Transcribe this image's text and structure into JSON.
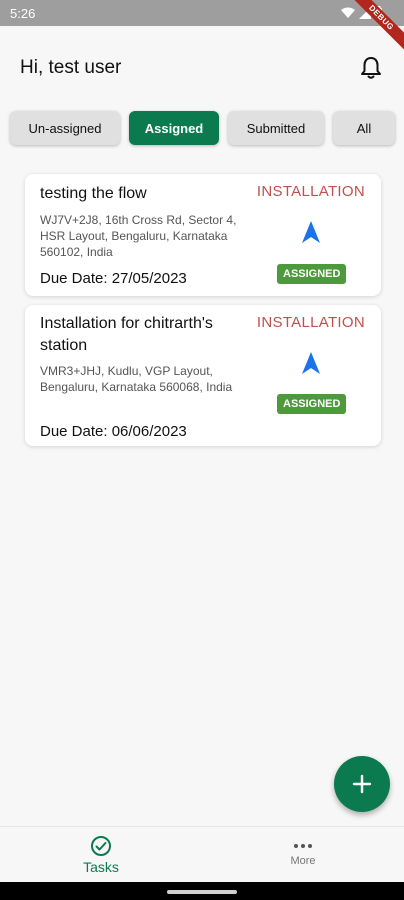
{
  "status_bar": {
    "time": "5:26",
    "debug_label": "DEBUG"
  },
  "header": {
    "greeting": "Hi, test user"
  },
  "filters": [
    {
      "label": "Un-assigned",
      "active": false
    },
    {
      "label": "Assigned",
      "active": true
    },
    {
      "label": "Submitted",
      "active": false
    },
    {
      "label": "All",
      "active": false
    }
  ],
  "tasks": [
    {
      "title": "testing the flow",
      "address": "WJ7V+2J8, 16th Cross Rd, Sector 4, HSR Layout, Bengaluru, Karnataka 560102, India",
      "due": "Due Date: 27/05/2023",
      "type": "INSTALLATION",
      "status": "ASSIGNED"
    },
    {
      "title": "Installation for chitrarth's station",
      "address": "VMR3+JHJ, Kudlu, VGP Layout, Bengaluru, Karnataka 560068, India",
      "due": "Due Date: 06/06/2023",
      "type": "INSTALLATION",
      "status": "ASSIGNED"
    }
  ],
  "fab": {
    "icon": "plus-icon"
  },
  "bottom_nav": [
    {
      "label": "Tasks",
      "icon": "check-circle-icon",
      "active": true
    },
    {
      "label": "More",
      "icon": "more-horizontal-icon",
      "active": false
    }
  ],
  "colors": {
    "primary": "#0b7a4f",
    "type": "#c0504d",
    "badge": "#4c9a3c",
    "arrow": "#1a73e8"
  }
}
